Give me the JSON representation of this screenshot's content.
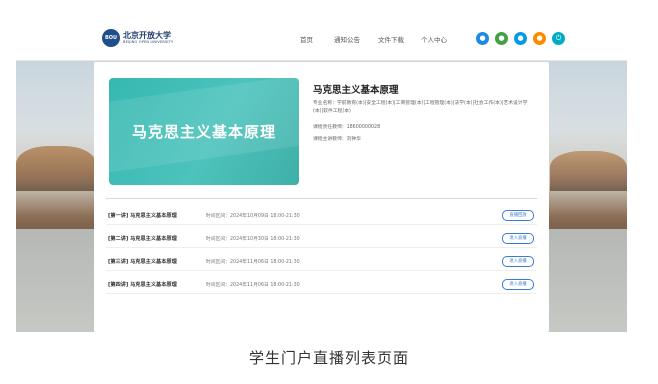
{
  "header": {
    "logo_badge": "BOU",
    "logo_cn": "北京开放大学",
    "logo_en": "BEIJING OPEN UNIVERSITY",
    "nav": [
      "首页",
      "通知公告",
      "文件下载",
      "个人中心"
    ],
    "icons": [
      {
        "name": "notice-icon",
        "glyph": "●",
        "color": "#1e88e5"
      },
      {
        "name": "chat-icon",
        "glyph": "●",
        "color": "#43a047"
      },
      {
        "name": "message-icon",
        "glyph": "●",
        "color": "#039be5"
      },
      {
        "name": "user-icon",
        "glyph": "●",
        "color": "#fb8c00"
      },
      {
        "name": "power-icon",
        "glyph": "⏻",
        "color": "#00acc1"
      }
    ]
  },
  "course": {
    "cover_title": "马克思主义基本原理",
    "title": "马克思主义基本原理",
    "majors": "专业名称：学前教育(本)|安全工程(本)|工商管理(本)|工程管理(本)|法学(本)|社会工作(本)|艺术设计学(本)|软件工程(本)",
    "teacher": "课程责任教师：18600000028",
    "lecturer": "课程主讲教师：刘钟华"
  },
  "lessons": [
    {
      "title": "[第一讲] 马克思主义基本原理",
      "time": "时间区间：2024年10月09日 18:00-21:30",
      "button": "直播回放"
    },
    {
      "title": "[第二讲] 马克思主义基本原理",
      "time": "时间区间：2024年10月30日 18:00-21:30",
      "button": "进入直播"
    },
    {
      "title": "[第三讲] 马克思主义基本原理",
      "time": "时间区间：2024年11月06日 18:00-21:30",
      "button": "进入直播"
    },
    {
      "title": "[第四讲] 马克思主义基本原理",
      "time": "时间区间：2024年11月06日 18:00-21:30",
      "button": "进入直播"
    }
  ],
  "caption": "学生门户直播列表页面"
}
